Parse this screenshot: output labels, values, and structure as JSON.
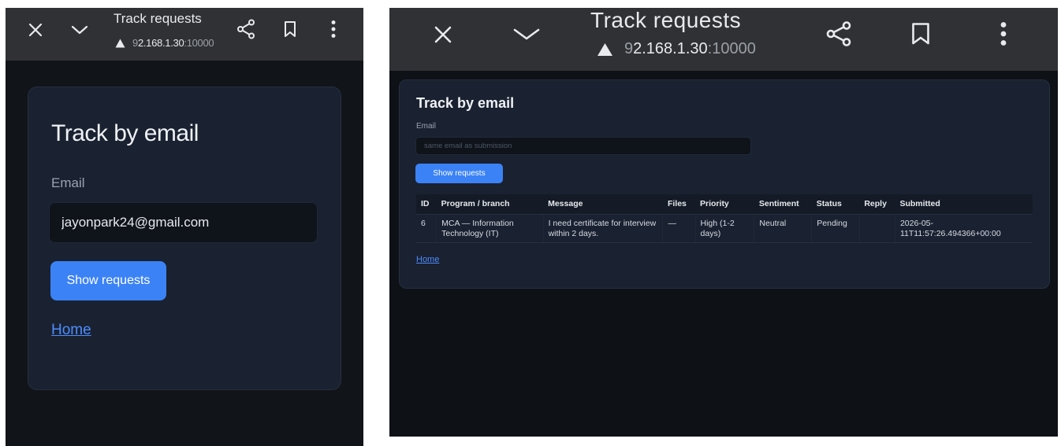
{
  "left": {
    "toolbar": {
      "title": "Track requests",
      "url_prefix": "9",
      "url_host": "2.168.1.30",
      "url_port": ":10000",
      "icons": [
        "close-icon",
        "chevron-down-icon",
        "warning-icon",
        "share-icon",
        "bookmark-icon",
        "more-vert-icon"
      ]
    },
    "card": {
      "title": "Track by email",
      "email_label": "Email",
      "email_value": "jayonpark24@gmail.com",
      "button_label": "Show requests",
      "home_link": "Home"
    }
  },
  "right": {
    "toolbar": {
      "title": "Track requests",
      "url_prefix": "9",
      "url_host": "2.168.1.30",
      "url_port": ":10000"
    },
    "card": {
      "title": "Track by email",
      "email_label": "Email",
      "email_placeholder": "same email as submission",
      "button_label": "Show requests",
      "home_link": "Home"
    },
    "table": {
      "columns": [
        "ID",
        "Program / branch",
        "Message",
        "Files",
        "Priority",
        "Sentiment",
        "Status",
        "Reply",
        "Submitted"
      ],
      "rows": [
        {
          "id": "6",
          "program": "MCA — Information Technology (IT)",
          "message": "I need certificate for interview within 2 days.",
          "files": "—",
          "priority": "High (1-2 days)",
          "sentiment": "Neutral",
          "status": "Pending",
          "reply": "",
          "submitted": "2026-05-11T11:57:26.494366+00:00"
        }
      ]
    }
  },
  "colors": {
    "accent": "#3b82f6",
    "link": "#4c8dff",
    "toolbar_bg": "#303134",
    "card_bg": "#1a2130",
    "page_bg": "#111418"
  }
}
